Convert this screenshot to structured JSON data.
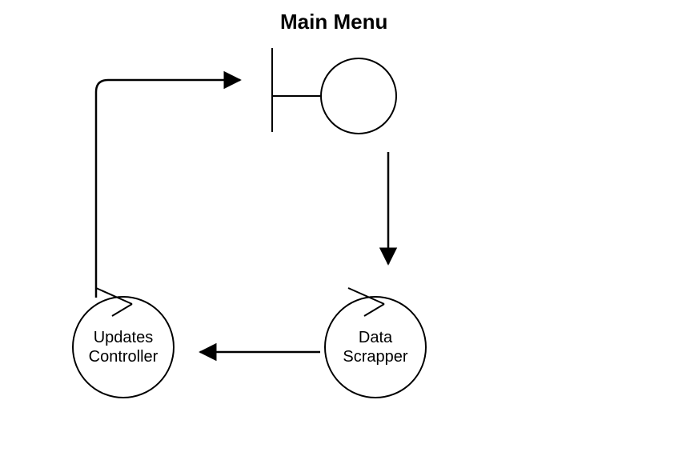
{
  "title": "Main Menu",
  "nodes": {
    "main": {
      "label": ""
    },
    "data_scrapper": {
      "label": "Data\nScrapper"
    },
    "updates_controller": {
      "label": "Updates\nController"
    }
  }
}
